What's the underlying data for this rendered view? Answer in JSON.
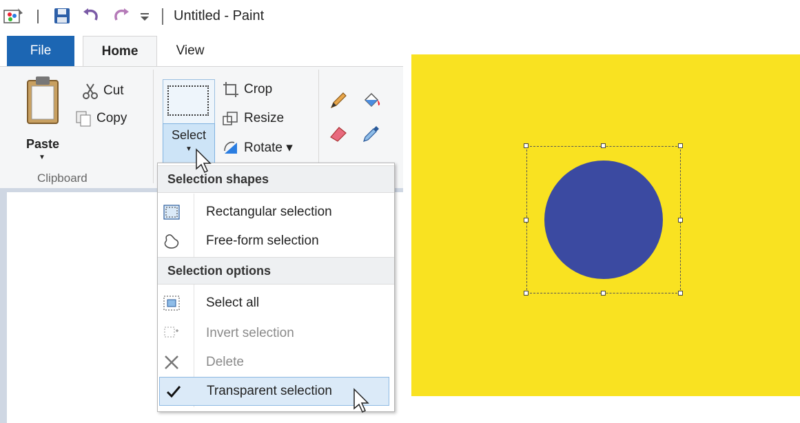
{
  "window": {
    "title": "Untitled - Paint"
  },
  "quick_access": {
    "icons": [
      "paint-app-icon",
      "save-icon",
      "undo-icon",
      "redo-icon",
      "customize-dropdown-icon"
    ]
  },
  "tabs": [
    {
      "label": "File"
    },
    {
      "label": "Home"
    },
    {
      "label": "View"
    }
  ],
  "ribbon": {
    "clipboard": {
      "paste_label": "Paste",
      "cut_label": "Cut",
      "copy_label": "Copy",
      "group_label": "Clipboard"
    },
    "image": {
      "select_label": "Select",
      "crop_label": "Crop",
      "resize_label": "Resize",
      "rotate_label": "Rotate ▾"
    },
    "tools": [
      "pencil-icon",
      "fill-icon",
      "eraser-icon",
      "color-picker-icon"
    ]
  },
  "select_menu": {
    "section_shapes": "Selection shapes",
    "items_shapes": [
      {
        "label": "Rectangular selection",
        "enabled": true
      },
      {
        "label": "Free-form selection",
        "enabled": true
      }
    ],
    "section_options": "Selection options",
    "items_options": [
      {
        "label": "Select all",
        "enabled": true
      },
      {
        "label": "Invert selection",
        "enabled": false
      },
      {
        "label": "Delete",
        "enabled": false
      },
      {
        "label": "Transparent selection",
        "enabled": true,
        "checked": true
      }
    ]
  },
  "canvas": {
    "background_color": "#f9e221",
    "shape": "circle",
    "shape_color": "#3b4aa1"
  },
  "colors": {
    "file_tab": "#1c66b3",
    "ribbon_bg": "#f5f6f7",
    "highlight": "#dbeaf8"
  }
}
